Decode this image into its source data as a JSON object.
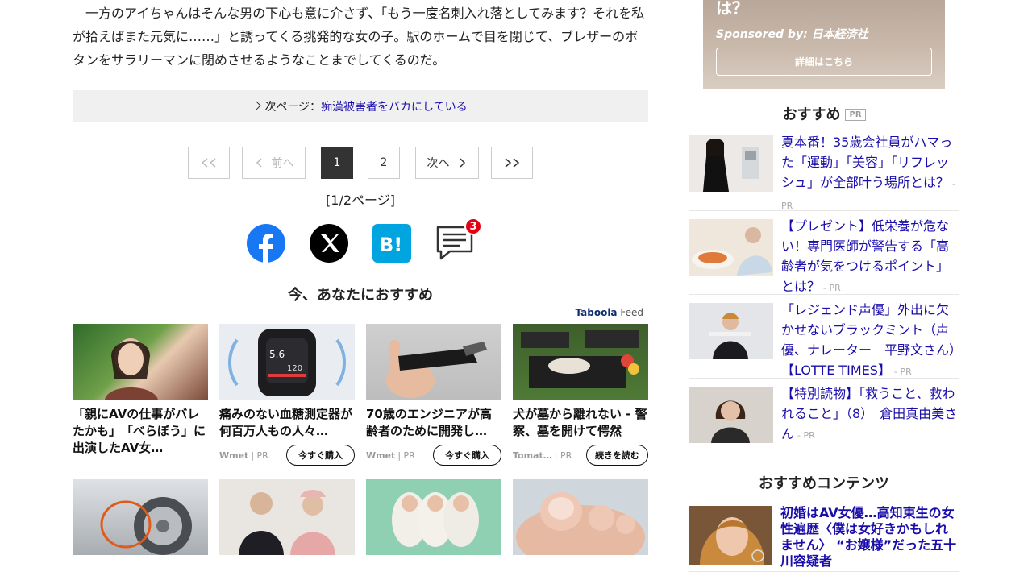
{
  "article": {
    "paragraph": "　一方のアイちゃんはそんな男の下心も意に介さず、「もう一度名刺入れ落としてみます？それを私が拾えばまた元気に……」と誘ってくる挑発的な女の子。駅のホームで目を閉じて、ブレザーのボタンをサラリーマンに閉めさせるようなことまでしてくるのだ。"
  },
  "next_page": {
    "prefix": "次ページ：",
    "link": "痴漢被害者をバカにしている"
  },
  "pager": {
    "first": "<<",
    "prev": "前へ",
    "page1": "1",
    "page2": "2",
    "next": "次へ",
    "last": ">>",
    "info": "[1/2ページ]"
  },
  "share": {
    "comment_count": "3"
  },
  "recommend": {
    "title": "今、あなたにおすすめ",
    "provider_a": "Taboola",
    "provider_b": "Feed",
    "cards": [
      {
        "title": "「親にAVの仕事がバレたかも」　「べらぼう」に出演したAV女…",
        "source": "",
        "pr": "",
        "button": ""
      },
      {
        "title": "痛みのない血糖測定器が何百万人もの人々…",
        "source": "Wmet",
        "pr": "| PR",
        "button": "今すぐ購入"
      },
      {
        "title": "70歳のエンジニアが高齢者のために開発し…",
        "source": "Wmet",
        "pr": "| PR",
        "button": "今すぐ購入"
      },
      {
        "title": "犬が墓から離れない - 警察、墓を開けて愕然",
        "source": "Tomat…",
        "pr": "| PR",
        "button": "続きを読む"
      }
    ]
  },
  "sidebar": {
    "ad": {
      "question_tail": "は？",
      "sponsored": "Sponsored by: 日本経済社",
      "button": "詳細はこちら"
    },
    "osusume_title": "おすすめ",
    "pr_tag": "PR",
    "items": [
      {
        "title": "夏本番！35歳会社員がハマった「運動」「美容」「リフレッシュ」が全部叶う場所とは？",
        "pr": "- PR"
      },
      {
        "title": "【プレゼント】低栄養が危ない！専門医師が警告する「高齢者が気をつけるポイント」とは？",
        "pr": "- PR"
      },
      {
        "title": "「レジェンド声優」外出に欠かせないブラックミント（声優、ナレーター　平野文さん）【LOTTE TIMES】",
        "pr": "- PR"
      },
      {
        "title": "【特別読物】「救うこと、救われること」（8）　倉田真由美さん",
        "pr": "- PR"
      }
    ],
    "contents_title": "おすすめコンテンツ",
    "content_item": {
      "title": "初婚はAV女優…高知東生の女性遍歴〈僕は女好きかもしれません〉 “お嬢様”だった五十川容疑者"
    }
  },
  "colors": {
    "link": "#1a0dab",
    "facebook": "#1877f2",
    "hatena": "#00a4de",
    "badge": "#e60012"
  }
}
